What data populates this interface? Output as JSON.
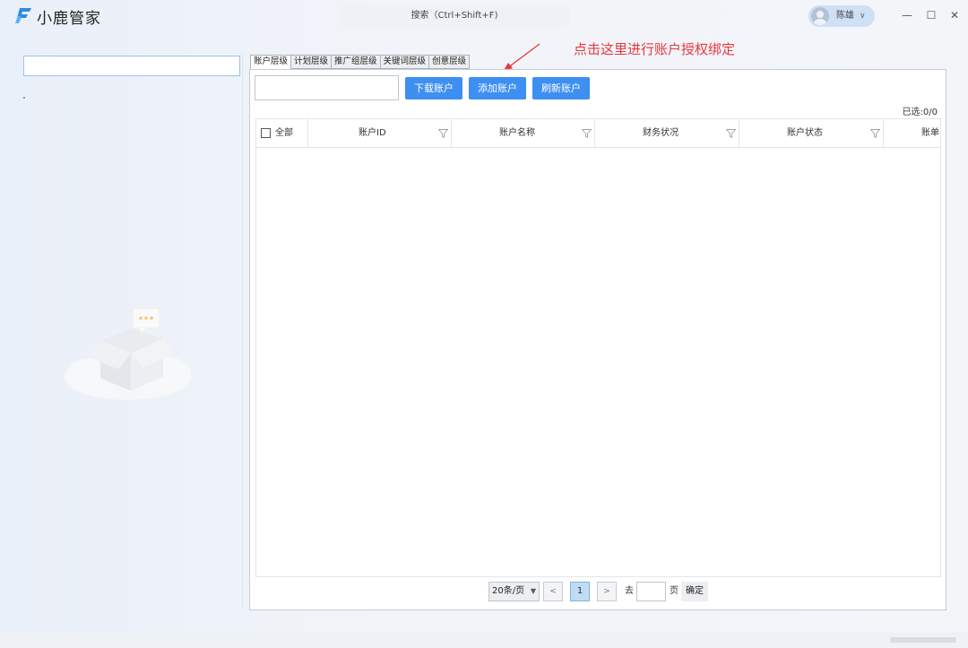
{
  "app": {
    "title": "小鹿管家"
  },
  "search": {
    "label": "搜索（Ctrl+Shift+F)"
  },
  "user": {
    "name": "陈雄"
  },
  "window_controls": {
    "minimize": "—",
    "maximize": "☐",
    "close": "✕"
  },
  "tabs": [
    {
      "label": "账户层级",
      "active": true
    },
    {
      "label": "计划层级",
      "active": false
    },
    {
      "label": "推广组层级",
      "active": false
    },
    {
      "label": "关键词层级",
      "active": false
    },
    {
      "label": "创意层级",
      "active": false
    }
  ],
  "annotation": {
    "text": "点击这里进行账户授权绑定",
    "color": "#e8383d"
  },
  "toolbar": {
    "download_label": "下载账户",
    "add_label": "添加账户",
    "refresh_label": "刷新账户",
    "accent": "#3d8ff2"
  },
  "selection": {
    "count_text": "已选:0/0"
  },
  "table": {
    "columns": [
      {
        "label": "全部",
        "filter": false
      },
      {
        "label": "账户ID",
        "filter": true
      },
      {
        "label": "账户名称",
        "filter": true
      },
      {
        "label": "财务状况",
        "filter": true
      },
      {
        "label": "账户状态",
        "filter": true
      },
      {
        "label": "账单",
        "filter": false
      }
    ],
    "rows": []
  },
  "pagination": {
    "page_size": "20条/页",
    "prev": "<",
    "current_page": "1",
    "next": ">",
    "goto_prefix": "去",
    "goto_suffix": "页",
    "confirm_label": "确定"
  }
}
